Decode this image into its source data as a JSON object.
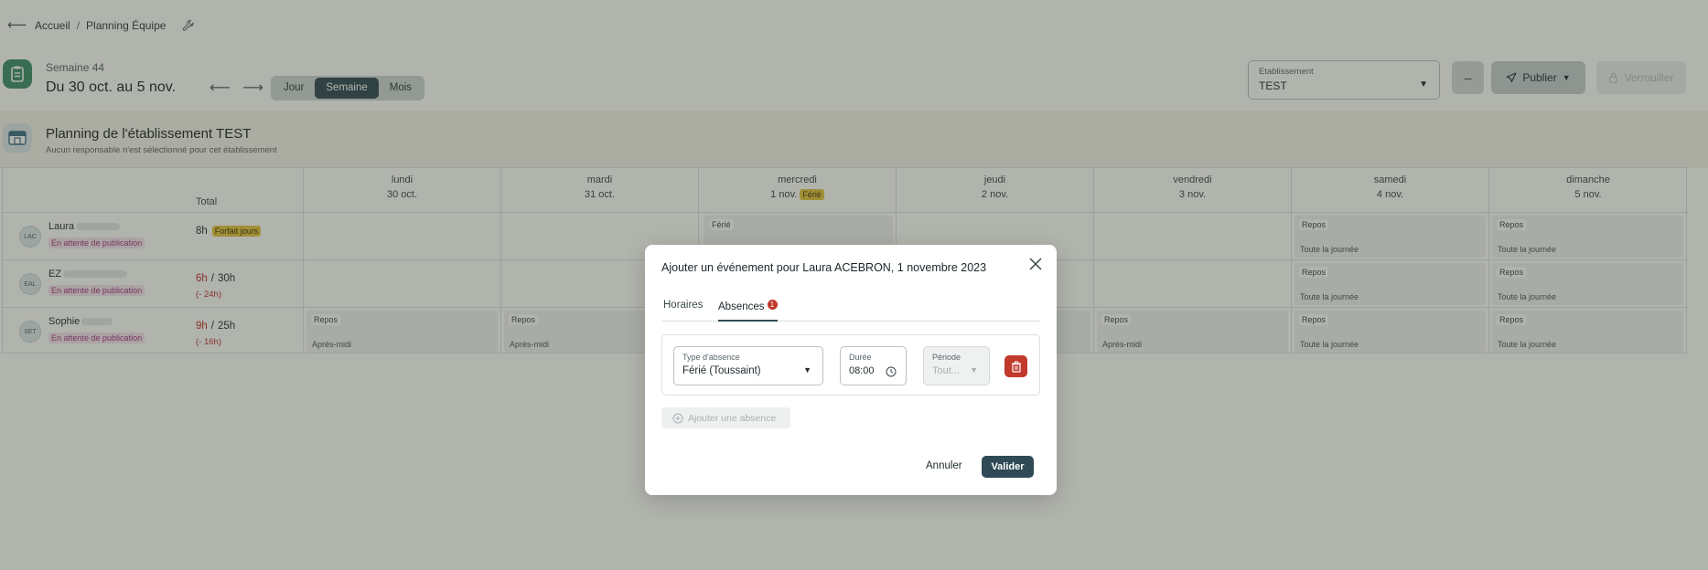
{
  "topbar": {
    "back_icon": "arrow-left-icon",
    "breadcrumb": [
      "Accueil",
      "Planning Équipe"
    ],
    "separator": "/",
    "settings_icon": "wrench-icon"
  },
  "week": {
    "label": "Semaine 44",
    "range": "Du 30 oct. au 5 nov.",
    "prev_icon": "arrow-left-icon",
    "next_icon": "arrow-right-icon",
    "views": [
      "Jour",
      "Semaine",
      "Mois"
    ],
    "active_view": "Semaine"
  },
  "establishment_select": {
    "label": "Etablissement",
    "value": "TEST"
  },
  "actions": {
    "minus": "–",
    "publish": "Publier",
    "lock": "Verrouiller"
  },
  "section": {
    "title": "Planning de l'établissement TEST",
    "subtitle": "Aucun responsable n'est sélectionné pour cet établissement"
  },
  "table": {
    "total_header": "Total",
    "days": [
      {
        "name": "lundi",
        "date": "30 oct.",
        "badge": ""
      },
      {
        "name": "mardi",
        "date": "31 oct.",
        "badge": ""
      },
      {
        "name": "mercredi",
        "date": "1 nov.",
        "badge": "Férié"
      },
      {
        "name": "jeudi",
        "date": "2 nov.",
        "badge": ""
      },
      {
        "name": "vendredi",
        "date": "3 nov.",
        "badge": ""
      },
      {
        "name": "samedi",
        "date": "4 nov.",
        "badge": ""
      },
      {
        "name": "dimanche",
        "date": "5 nov.",
        "badge": ""
      }
    ],
    "rows": [
      {
        "initials": "LAC",
        "name": "Laura",
        "status": "En attente de publication",
        "hours": "8h",
        "contract": "",
        "extra": "Forfait jours",
        "delta": ""
      },
      {
        "initials": "EAL",
        "name": "EZ",
        "status": "En attente de publication",
        "hours": "6h",
        "contract": "30h",
        "extra": "",
        "delta": "(- 24h)"
      },
      {
        "initials": "SET",
        "name": "Sophie",
        "status": "En attente de publication",
        "hours": "9h",
        "contract": "25h",
        "extra": "",
        "delta": "(- 16h)"
      }
    ],
    "cell_labels": {
      "ferie": "Férié",
      "repos": "Repos",
      "toute_journee": "Toute la journée",
      "apres_midi": "Après-midi"
    }
  },
  "modal": {
    "title": "Ajouter un événement pour Laura ACEBRON, 1 novembre 2023",
    "tabs": [
      "Horaires",
      "Absences"
    ],
    "active_tab": "Absences",
    "absences_count": "1",
    "absence": {
      "type_label": "Type d'absence",
      "type_value": "Férié (Toussaint)",
      "duration_label": "Durée",
      "duration_value": "08:00",
      "period_label": "Période",
      "period_value": "Tout..."
    },
    "add_absence": "Ajouter une absence",
    "cancel": "Annuler",
    "validate": "Valider"
  },
  "colors": {
    "accent": "#2f4a54",
    "danger": "#c0392b",
    "brand_green": "#3e8f6c",
    "badge_yellow": "#e6c53f"
  }
}
